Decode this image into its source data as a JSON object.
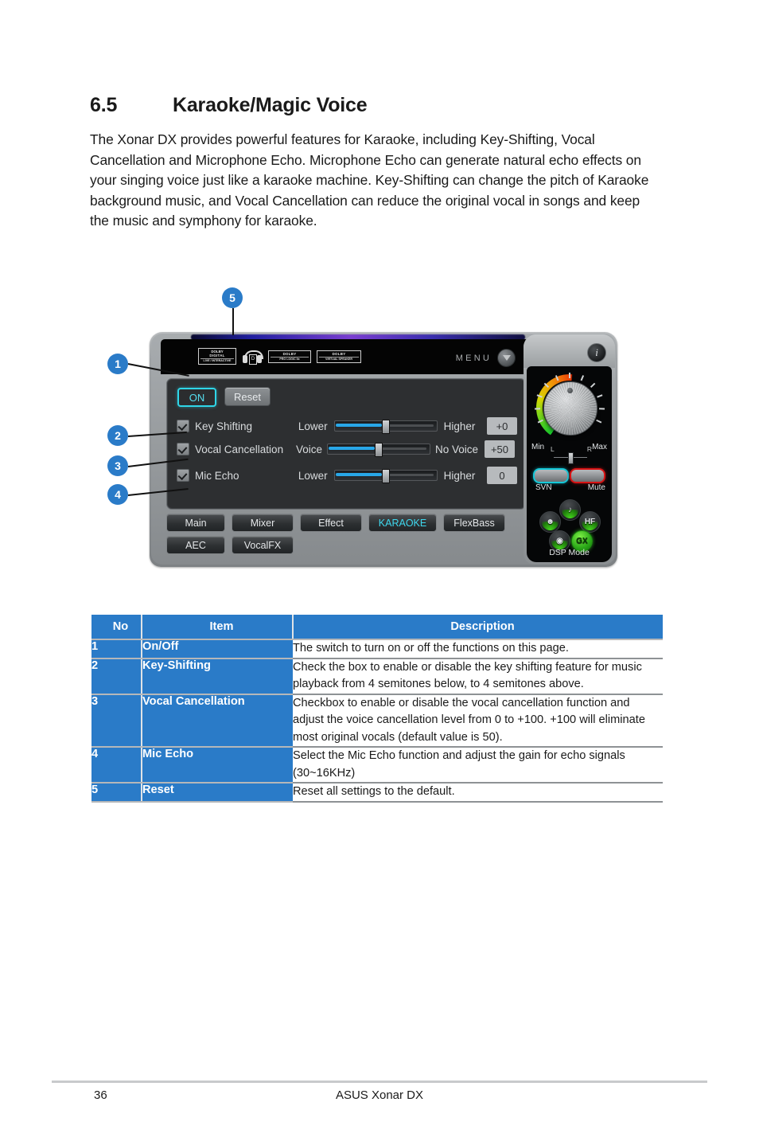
{
  "section": {
    "number": "6.5",
    "title": "Karaoke/Magic Voice",
    "intro": "The Xonar DX provides powerful features for Karaoke, including Key-Shifting, Vocal Cancellation and Microphone Echo. Microphone Echo can generate natural echo effects on your singing voice just like a karaoke machine. Key-Shifting can change the pitch of Karaoke background music, and Vocal Cancellation can reduce the original vocal in songs and keep the music and symphony for karaoke."
  },
  "callouts": [
    {
      "id": "1",
      "label": "1"
    },
    {
      "id": "2",
      "label": "2"
    },
    {
      "id": "3",
      "label": "3"
    },
    {
      "id": "4",
      "label": "4"
    },
    {
      "id": "5",
      "label": "5"
    }
  ],
  "app": {
    "header": {
      "dolby_digital_top": "DOLBY",
      "dolby_digital_mid": "DIGITAL",
      "dolby_digital_sub": "LIVE / INTERACTIVE",
      "headphone_icon": "headphone-icon",
      "dolby_prologic_top": "DOLBY",
      "dolby_prologic_sub": "PRO LOGIC IIx",
      "dolby_virtual_top": "DOLBY",
      "dolby_virtual_sub": "VIRTUAL SPEAKER",
      "menu_label": "MENU",
      "menu_caret": "chevron-down-icon",
      "info_icon": "i"
    },
    "controls": {
      "on_label": "ON",
      "reset_label": "Reset"
    },
    "rows": [
      {
        "name": "Key Shifting",
        "checked": true,
        "left_label": "Lower",
        "right_label": "Higher",
        "value": "+0",
        "position_pct": 50
      },
      {
        "name": "Vocal Cancellation",
        "checked": true,
        "left_label": "Voice",
        "right_label": "No Voice",
        "value": "+50",
        "position_pct": 50
      },
      {
        "name": "Mic Echo",
        "checked": true,
        "left_label": "Lower",
        "right_label": "Higher",
        "value": "0",
        "position_pct": 50
      }
    ],
    "tabs_row1": [
      {
        "label": "Main",
        "active": false
      },
      {
        "label": "Mixer",
        "active": false
      },
      {
        "label": "Effect",
        "active": false
      },
      {
        "label": "KARAOKE",
        "active": true
      },
      {
        "label": "FlexBass",
        "active": false
      }
    ],
    "tabs_row2": [
      {
        "label": "AEC",
        "active": false
      },
      {
        "label": "VocalFX",
        "active": false
      }
    ],
    "volume": {
      "min_label": "Min",
      "max_label": "Max",
      "left_label": "L",
      "right_label": "R",
      "svn_label": "SVN",
      "mute_label": "Mute",
      "dsp_label": "DSP Mode",
      "dsp_icons": [
        "ghost-icon",
        "music-note-icon",
        "HF",
        "game-icon",
        "GX"
      ]
    },
    "accent_colors": {
      "cyan": "#3ed8ee",
      "slider_blue": "#28a7e8",
      "mute_red": "#d81414",
      "gx_green": "#46d81e"
    }
  },
  "table": {
    "headers": [
      "No",
      "Item",
      "Description"
    ],
    "rows": [
      {
        "no": "1",
        "item": "On/Off",
        "desc": "The switch to turn on or off the functions on this page."
      },
      {
        "no": "2",
        "item": "Key-Shifting",
        "desc": "Check the box to enable or disable the key shifting feature for music playback from 4 semitones below, to 4 semitones above."
      },
      {
        "no": "3",
        "item": "Vocal Cancellation",
        "desc": "Checkbox to enable or disable the vocal cancellation function and adjust the voice cancellation level from 0 to +100. +100 will eliminate most original vocals (default value is 50)."
      },
      {
        "no": "4",
        "item": "Mic Echo",
        "desc": "Select the Mic Echo function and adjust the gain for echo signals (30~16KHz)"
      },
      {
        "no": "5",
        "item": "Reset",
        "desc": "Reset all settings to the default."
      }
    ],
    "header_color": "#2a7bc8"
  },
  "footer": {
    "page_number": "36",
    "product": "ASUS Xonar DX"
  }
}
